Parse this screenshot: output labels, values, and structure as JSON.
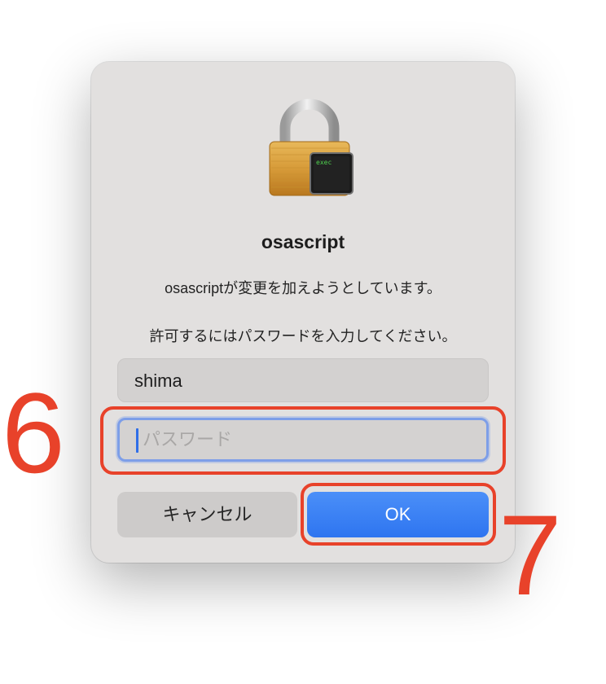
{
  "dialog": {
    "app_title": "osascript",
    "message_line1": "osascriptが変更を加えようとしています。",
    "message_line2": "許可するにはパスワードを入力してください。",
    "lock_icon": {
      "icon_name": "padlock-icon",
      "badge_text": "exec"
    },
    "username_value": "shima",
    "password_placeholder": "パスワード",
    "cancel_label": "キャンセル",
    "ok_label": "OK"
  },
  "annotations": {
    "marker_6": "6",
    "marker_7": "7",
    "color": "#e8422a"
  },
  "colors": {
    "accent": "#2e75f0",
    "focus_ring": "#7d9ee8"
  }
}
